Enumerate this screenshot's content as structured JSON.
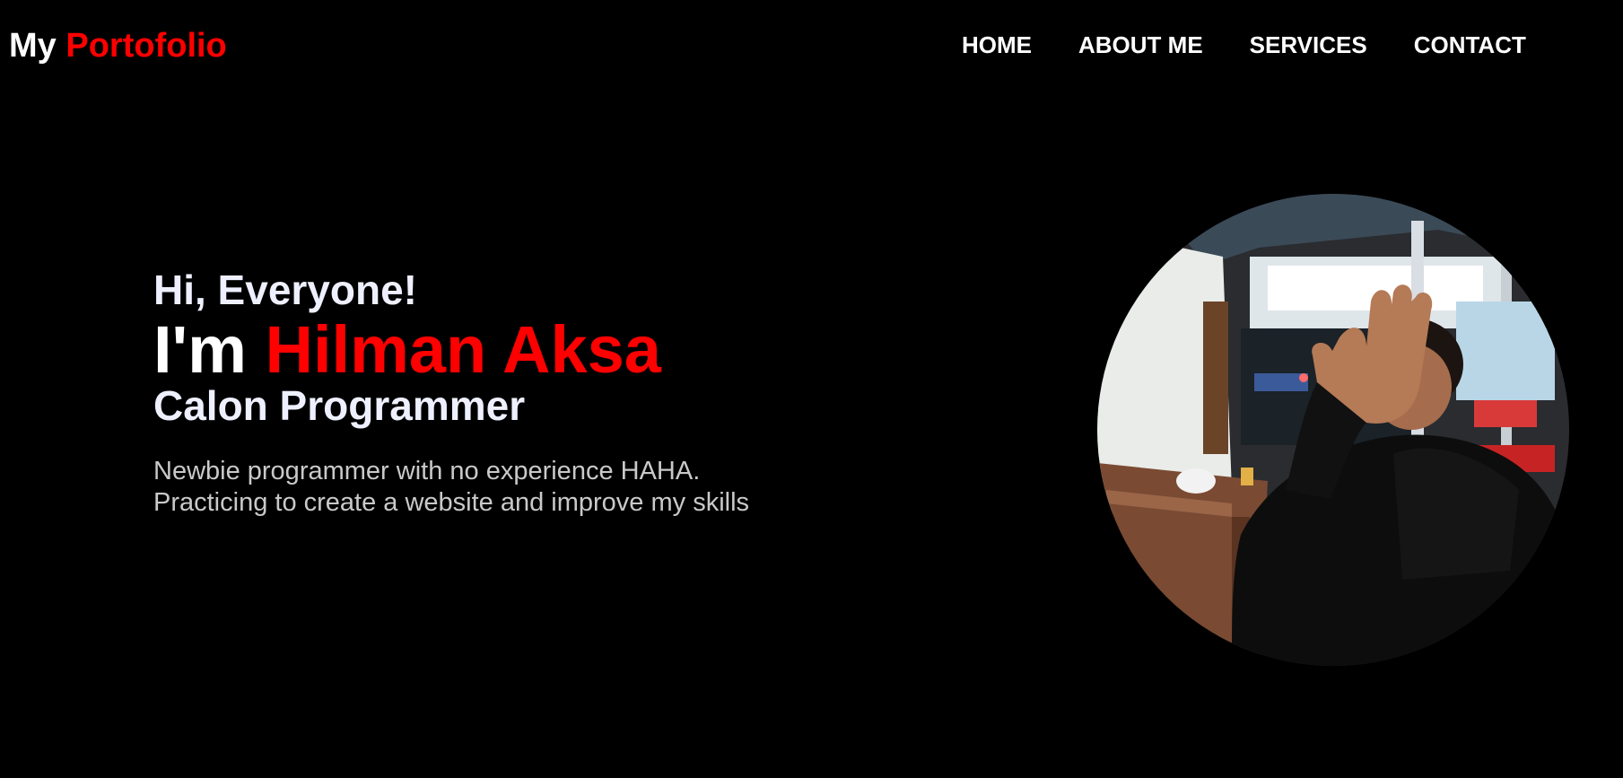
{
  "brand": {
    "first": "My",
    "accent": "Portofolio"
  },
  "nav": {
    "items": [
      {
        "label": "HOME"
      },
      {
        "label": "ABOUT ME"
      },
      {
        "label": "SERVICES"
      },
      {
        "label": "CONTACT"
      }
    ]
  },
  "hero": {
    "greeting": "Hi, Everyone!",
    "intro_prefix": "I'm",
    "name": "Hilman Aksa",
    "role": "Calon Programmer",
    "description_line1": "Newbie programmer with no experience HAHA.",
    "description_line2": "Practicing to create a website and improve my skills"
  },
  "colors": {
    "background": "#000000",
    "accent": "#ff0000",
    "text": "#ffffff",
    "muted": "#c9c9c9"
  }
}
